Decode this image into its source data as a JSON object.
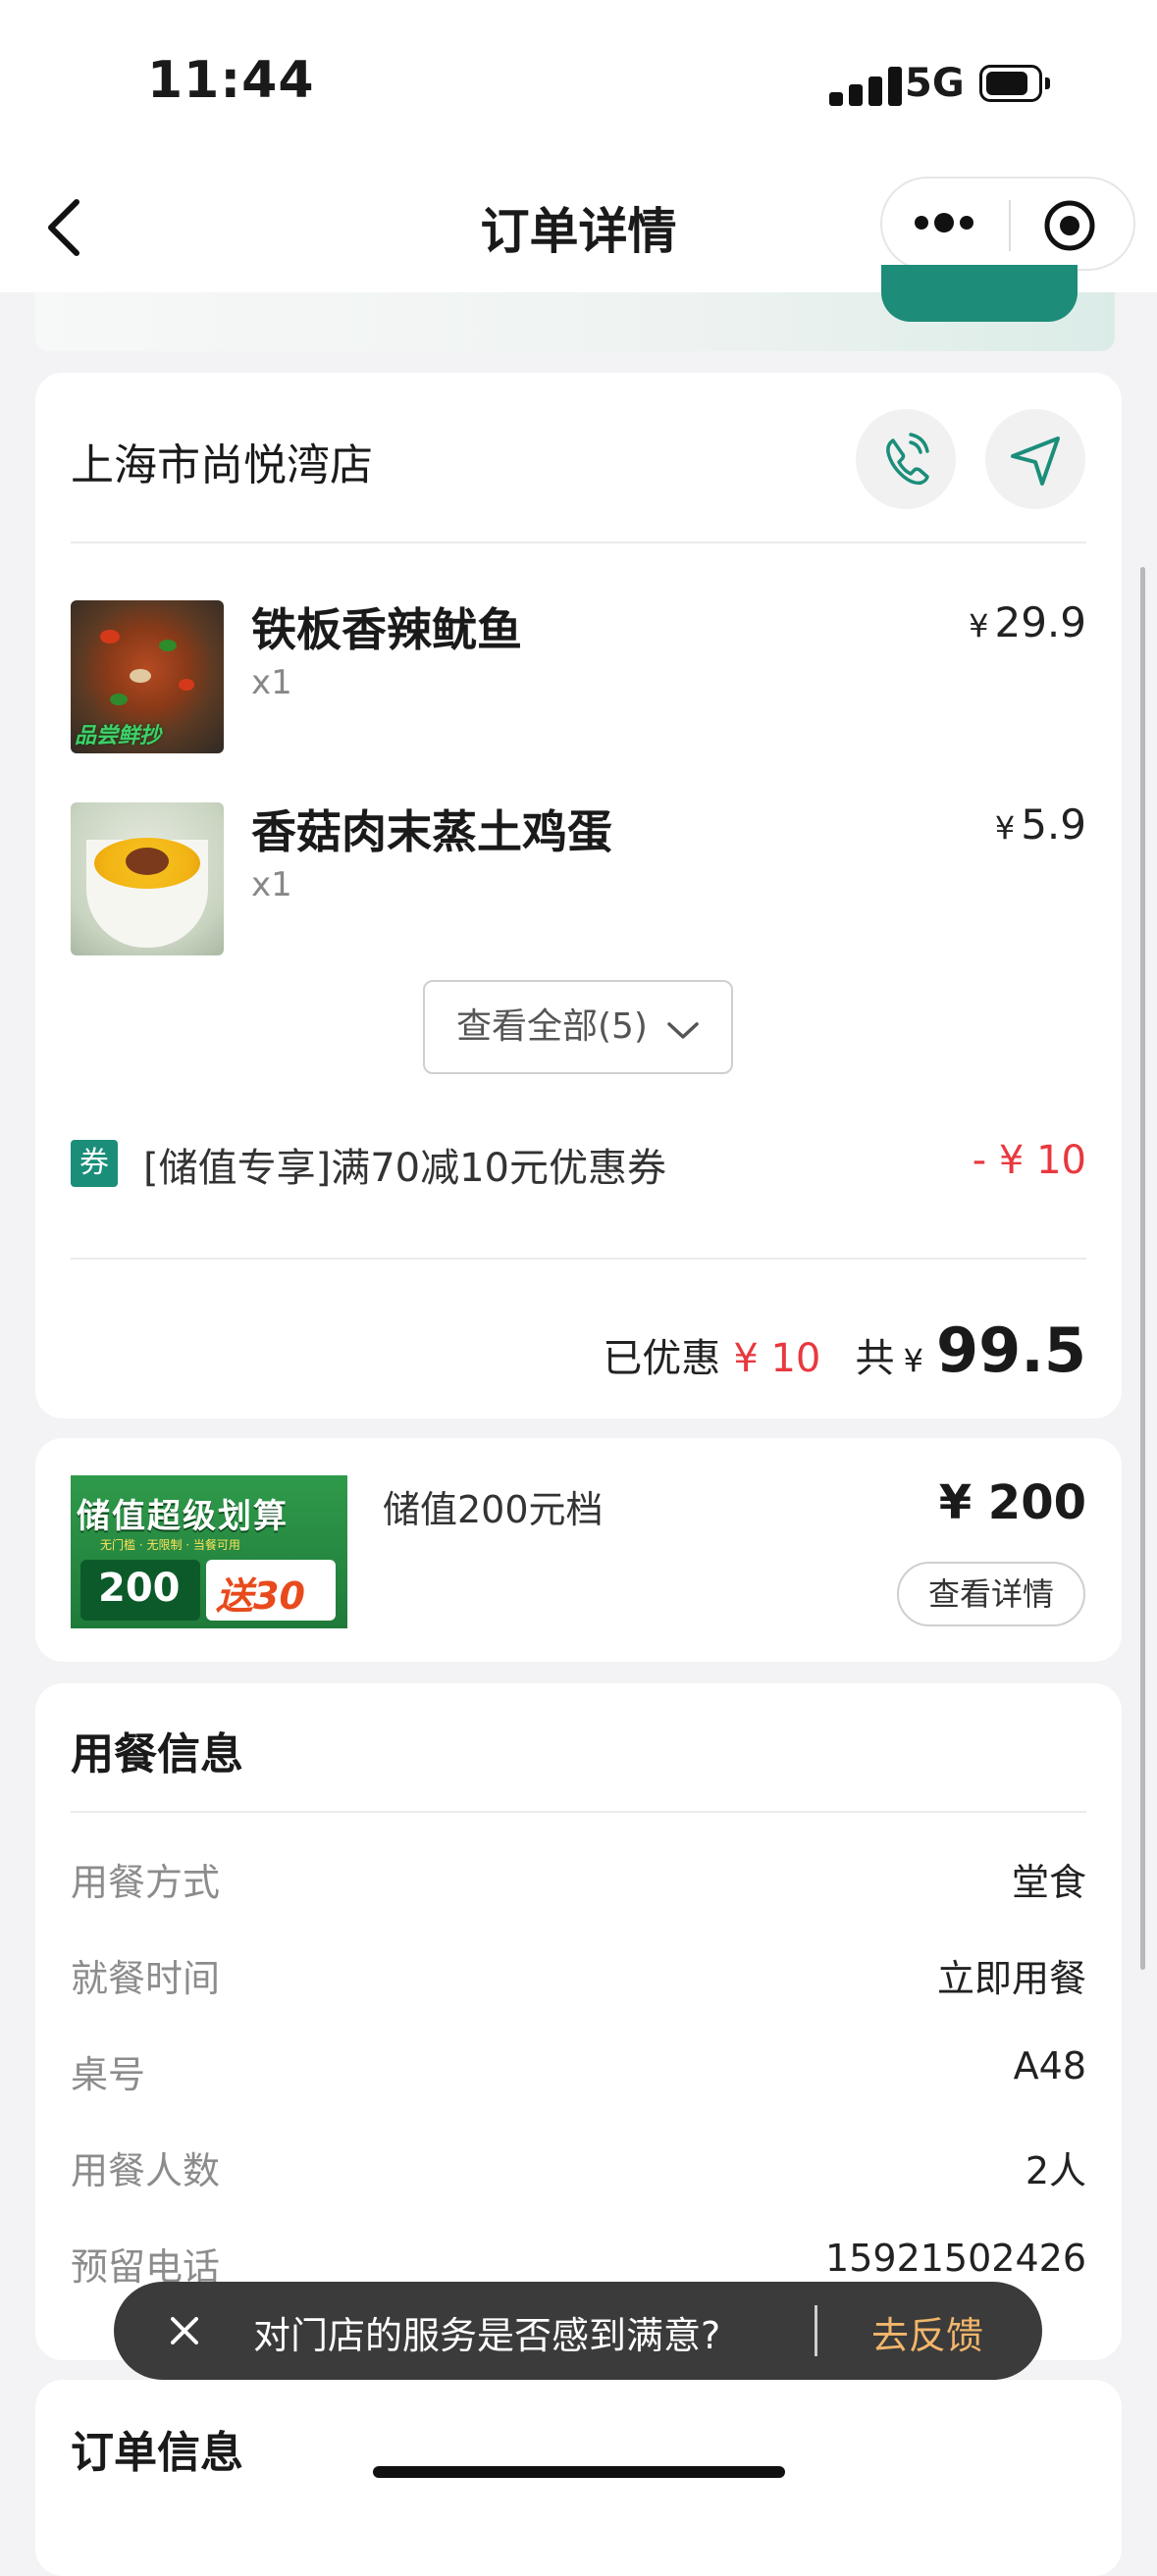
{
  "status_bar": {
    "time": "11:44",
    "network": "5G"
  },
  "nav": {
    "title": "订单详情"
  },
  "store": {
    "name": "上海市尚悦湾店",
    "items": [
      {
        "name": "铁板香辣鱿鱼",
        "qty": "x1",
        "currency": "¥",
        "price": "29.9",
        "image_tag": "品尝鲜抄"
      },
      {
        "name": "香菇肉末蒸土鸡蛋",
        "qty": "x1",
        "currency": "¥",
        "price": "5.9"
      }
    ],
    "view_all_label": "查看全部(5)",
    "coupon": {
      "badge": "券",
      "text": "[储值专享]满70减10元优惠券",
      "amount": "- ¥ 10"
    },
    "summary": {
      "discount_label": "已优惠",
      "discount_value": "¥ 10",
      "total_label": "共",
      "currency": "¥",
      "total_value": "99.5"
    }
  },
  "membership": {
    "image_title": "储值超级划算",
    "image_subtitle": "无门槛 · 无限制 · 当餐可用",
    "image_amount": "200",
    "image_bonus": "送30",
    "title": "储值200元档",
    "price": "¥ 200",
    "detail_button": "查看详情"
  },
  "dining": {
    "title": "用餐信息",
    "rows": [
      {
        "label": "用餐方式",
        "value": "堂食"
      },
      {
        "label": "就餐时间",
        "value": "立即用餐"
      },
      {
        "label": "桌号",
        "value": "A48"
      },
      {
        "label": "用餐人数",
        "value": "2人"
      },
      {
        "label": "预留电话",
        "value": "15921502426"
      }
    ]
  },
  "order_info": {
    "title": "订单信息"
  },
  "toast": {
    "text": "对门店的服务是否感到满意?",
    "action": "去反馈"
  },
  "colors": {
    "accent": "#1b8e7a",
    "price_red": "#e8383f",
    "toast_action": "#f2b66b"
  }
}
